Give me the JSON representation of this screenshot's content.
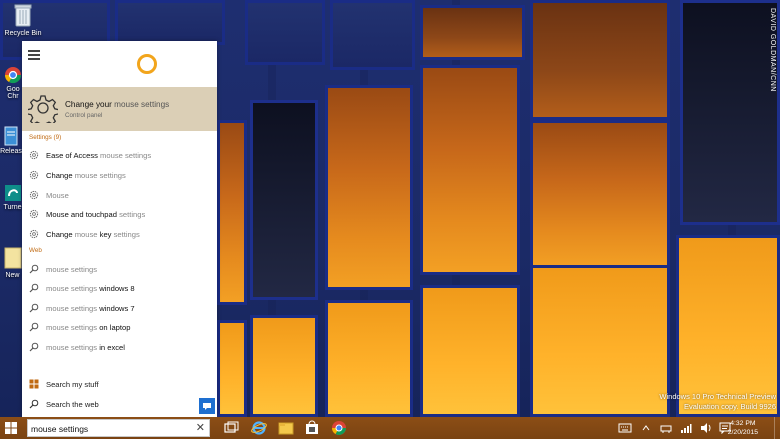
{
  "desktop": {
    "watermark": "DAVID GOLDMAN/CNN",
    "icons": [
      {
        "label": "Recycle Bin",
        "icon": "recycle-bin-icon"
      },
      {
        "label": "Goo Chr",
        "icon": "chrome-icon"
      },
      {
        "label": "Releas",
        "icon": "release-notes-icon"
      },
      {
        "label": "Turne",
        "icon": "turner-icon"
      },
      {
        "label": "New",
        "icon": "folder-icon"
      }
    ],
    "evaluation": {
      "line1": "Windows 10 Pro Technical Preview",
      "line2": "Evaluation copy. Build 9926"
    }
  },
  "cortana": {
    "best_match": {
      "title_prefix": "Change your",
      "title_query": "mouse settings",
      "subtitle": "Control panel",
      "icon": "gear-icon"
    },
    "settings_header": "Settings (9)",
    "settings": [
      {
        "before": "Ease of Access",
        "match": "mouse settings",
        "after": ""
      },
      {
        "before": "Change",
        "match": "mouse settings",
        "after": ""
      },
      {
        "before": "",
        "match": "Mouse",
        "after": ""
      },
      {
        "before": "",
        "match": "Mouse",
        "after": "and touchpad",
        "tail": "settings"
      },
      {
        "before": "Change",
        "match": "mouse",
        "after": "key",
        "tail": "settings"
      }
    ],
    "web_header": "Web",
    "web": [
      {
        "match": "mouse settings",
        "suffix": ""
      },
      {
        "match": "mouse settings",
        "suffix": "windows 8"
      },
      {
        "match": "mouse settings",
        "suffix": "windows 7"
      },
      {
        "match": "mouse settings",
        "suffix": "on laptop"
      },
      {
        "match": "mouse settings",
        "suffix": "in excel"
      }
    ],
    "search_my_stuff": "Search my stuff",
    "search_the_web": "Search the web"
  },
  "taskbar": {
    "search_value": "mouse settings",
    "clear_glyph": "✕",
    "apps": [
      "task-view-icon",
      "internet-explorer-icon",
      "file-explorer-icon",
      "store-icon",
      "chrome-icon"
    ],
    "time": "4:32 PM",
    "date": "2/20/2015"
  },
  "colors": {
    "cortana_accent": "#f2a51c",
    "best_match_bg": "#dbcfb6",
    "group_label": "#c06a12",
    "taskbar": "#7a4312"
  }
}
